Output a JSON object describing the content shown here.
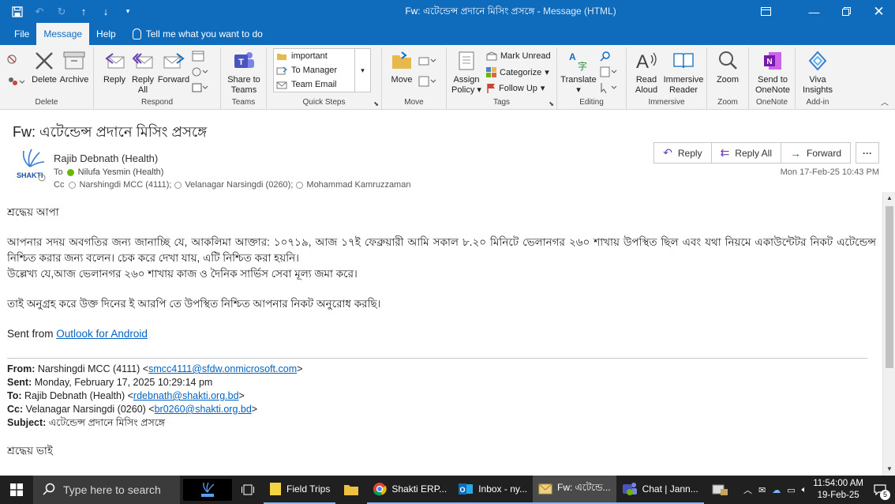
{
  "window": {
    "title_subject": "Fw: এটেন্ডেন্স প্রদানে মিসিং প্রসঙ্গে",
    "title_suffix": "Message (HTML)"
  },
  "ribbon_tabs": [
    "File",
    "Message",
    "Help"
  ],
  "tell_me": "Tell me what you want to do",
  "ribbon": {
    "delete_group": {
      "label": "Delete",
      "delete": "Delete",
      "archive": "Archive"
    },
    "respond_group": {
      "label": "Respond",
      "reply": "Reply",
      "reply_all_1": "Reply",
      "reply_all_2": "All",
      "forward": "Forward"
    },
    "teams_group": {
      "label": "Teams",
      "share_1": "Share to",
      "share_2": "Teams"
    },
    "quick_steps": {
      "label": "Quick Steps",
      "items": [
        "important",
        "To Manager",
        "Team Email"
      ]
    },
    "move_group": {
      "label": "Move",
      "move": "Move"
    },
    "tags_group": {
      "label": "Tags",
      "assign_1": "Assign",
      "assign_2": "Policy",
      "mark_unread": "Mark Unread",
      "categorize": "Categorize",
      "follow_up": "Follow Up"
    },
    "editing_group": {
      "label": "Editing",
      "translate": "Translate"
    },
    "immersive_group": {
      "label": "Immersive",
      "read_1": "Read",
      "read_2": "Aloud",
      "immersive_1": "Immersive",
      "immersive_2": "Reader"
    },
    "zoom_group": {
      "label": "Zoom",
      "zoom": "Zoom"
    },
    "onenote_group": {
      "label": "OneNote",
      "send_1": "Send to",
      "send_2": "OneNote"
    },
    "addin_group": {
      "label": "Add-in",
      "viva_1": "Viva",
      "viva_2": "Insights"
    }
  },
  "message": {
    "subject": "Fw: এটেন্ডেন্স প্রদানে মিসিং প্রসঙ্গে",
    "sender": "Rajib Debnath (Health)",
    "to_label": "To",
    "to": "Nilufa Yesmin (Health)",
    "cc_label": "Cc",
    "cc": [
      "Narshingdi MCC (4111);",
      "Velanagar Narsingdi (0260);",
      "Mohammad  Kamruzzaman"
    ],
    "date": "Mon 17-Feb-25 10:43 PM",
    "actions": {
      "reply": "Reply",
      "reply_all": "Reply All",
      "forward": "Forward"
    }
  },
  "body": {
    "greeting": "শ্রদ্ধেয় আপা",
    "para1": "আপনার সদয় অবগতির জন্য জানাচ্ছি যে, আকলিমা আক্তার: ১০৭১৯, আজ ১৭ই ফেব্রুয়ারী আমি সকাল ৮.২০ মিনিটে ভেলানগর ২৬০ শাখায় উপস্থিত ছিল এবং যথা নিয়মে একাউন্টেটর নিকট এটেন্ডেন্স নিশ্চিত করার জন্য বলেন। চেক করে দেখা যায়, এটি নিশ্চিত করা হয়নি।",
    "para2": " উল্লেখ্য যে,আজ ভেলানগর ২৬০ শাখায় কাজ ও দৈনিক সার্ভিস সেবা মূল্য জমা করে।",
    "para3": "তাই অনুগ্রহ করে উক্ত দিনের ই আরপি তে উপস্থিত নিশ্চিত আপনার নিকট অনুরোধ করছি।",
    "sent_from": "Sent from ",
    "sent_link": "Outlook for Android",
    "fw_from_label": "From:",
    "fw_from": " Narshingdi MCC (4111) <",
    "fw_from_email": "smcc4111@sfdw.onmicrosoft.com",
    "fw_sent_label": "Sent:",
    "fw_sent": " Monday, February 17, 2025 10:29:14 pm",
    "fw_to_label": "To:",
    "fw_to": " Rajib Debnath (Health) <",
    "fw_to_email": "rdebnath@shakti.org.bd",
    "fw_cc_label": "Cc:",
    "fw_cc": " Velanagar Narsingdi (0260) <",
    "fw_cc_email": "br0260@shakti.org.bd",
    "fw_subject_label": "Subject:",
    "fw_subject": " এটেন্ডেন্স প্রদানে মিসিং প্রসঙ্গে",
    "fw_greeting": "শ্রদ্ধেয় ভাই",
    "close_bracket": ">"
  },
  "taskbar": {
    "search": "Type here to search",
    "apps": [
      "Field Trips",
      "Shakti ERP...",
      "Inbox - ny...",
      "Fw: এটেন্ডে...",
      "Chat | Jann..."
    ],
    "time": "11:54:00 AM",
    "date": "19-Feb-25",
    "notifications": "5"
  },
  "colors": {
    "accent": "#0f6cbd",
    "link": "#0563c1",
    "taskbar": "#202020"
  }
}
